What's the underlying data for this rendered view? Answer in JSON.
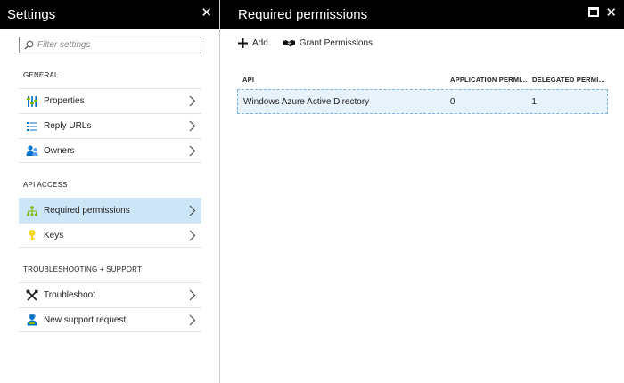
{
  "settings": {
    "title": "Settings",
    "close": "✕",
    "filter_placeholder": "Filter settings",
    "sections": [
      {
        "label": "GENERAL",
        "items": [
          {
            "label": "Properties"
          },
          {
            "label": "Reply URLs"
          },
          {
            "label": "Owners"
          }
        ]
      },
      {
        "label": "API ACCESS",
        "items": [
          {
            "label": "Required permissions",
            "selected": true
          },
          {
            "label": "Keys"
          }
        ]
      },
      {
        "label": "TROUBLESHOOTING + SUPPORT",
        "items": [
          {
            "label": "Troubleshoot"
          },
          {
            "label": "New support request"
          }
        ]
      }
    ]
  },
  "permissions": {
    "title": "Required permissions",
    "close": "✕",
    "commands": {
      "add": "Add",
      "grant": "Grant Permissions"
    },
    "columns": [
      "API",
      "APPLICATION PERMI...",
      "DELEGATED PERMIS..."
    ],
    "rows": [
      {
        "api": "Windows Azure Active Directory",
        "application": "0",
        "delegated": "1"
      }
    ]
  },
  "colors": {
    "titlebar": "#000000",
    "selected": "#cce5f7",
    "accent": "#0072c6"
  }
}
